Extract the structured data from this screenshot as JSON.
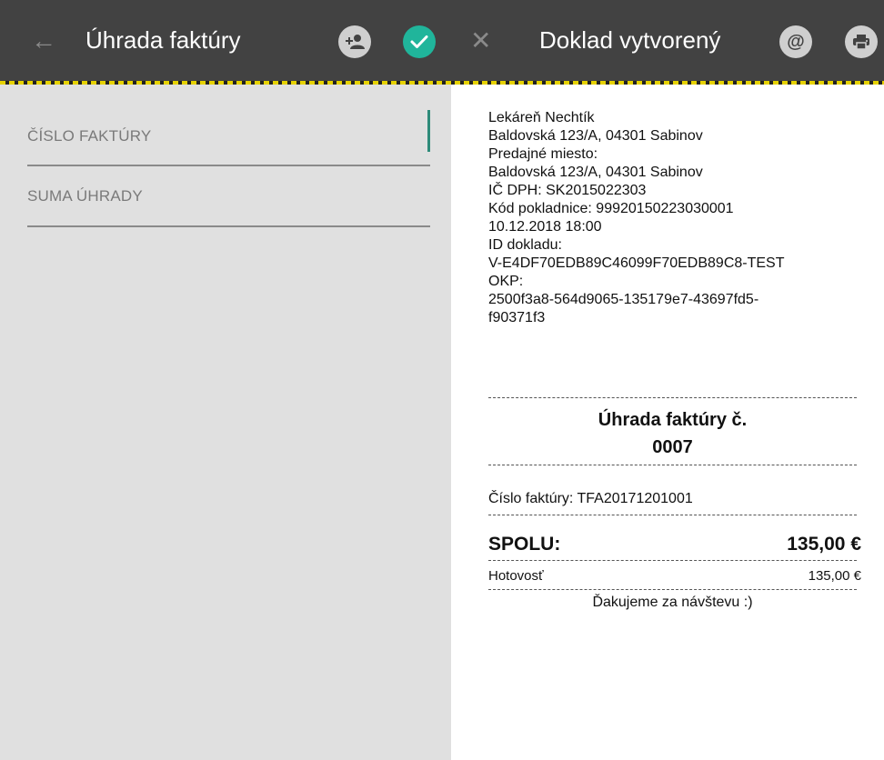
{
  "left_toolbar": {
    "title": "Úhrada faktúry",
    "back_icon": "←"
  },
  "right_toolbar": {
    "title": "Doklad vytvorený",
    "close_icon": "✕",
    "email_icon": "@"
  },
  "form": {
    "invoice_number_label": "ČÍSLO FAKTÚRY",
    "amount_label": "SUMA ÚHRADY"
  },
  "receipt": {
    "header_lines": [
      "Lekáreň Nechtík",
      "Baldovská 123/A, 04301 Sabinov",
      "Predajné miesto:",
      "Baldovská 123/A, 04301 Sabinov",
      "IČ DPH: SK2015022303",
      "Kód pokladnice: 99920150223030001",
      "10.12.2018 18:00",
      "ID dokladu:",
      "V-E4DF70EDB89C46099F70EDB89C8-TEST",
      "OKP:",
      "2500f3a8-564d9065-135179e7-43697fd5-",
      "f90371f3"
    ],
    "title_line1": "Úhrada faktúry č.",
    "title_line2": "0007",
    "invoice_ref": "Číslo faktúry: TFA20171201001",
    "total_label": "SPOLU:",
    "total_value": "135,00 €",
    "cash_label": "Hotovosť",
    "cash_value": "135,00 €",
    "thanks": "Ďakujeme za návštevu :)"
  },
  "colors": {
    "toolbar": "#424242",
    "accent": "#20b59b",
    "panel": "#e0e0e0"
  }
}
